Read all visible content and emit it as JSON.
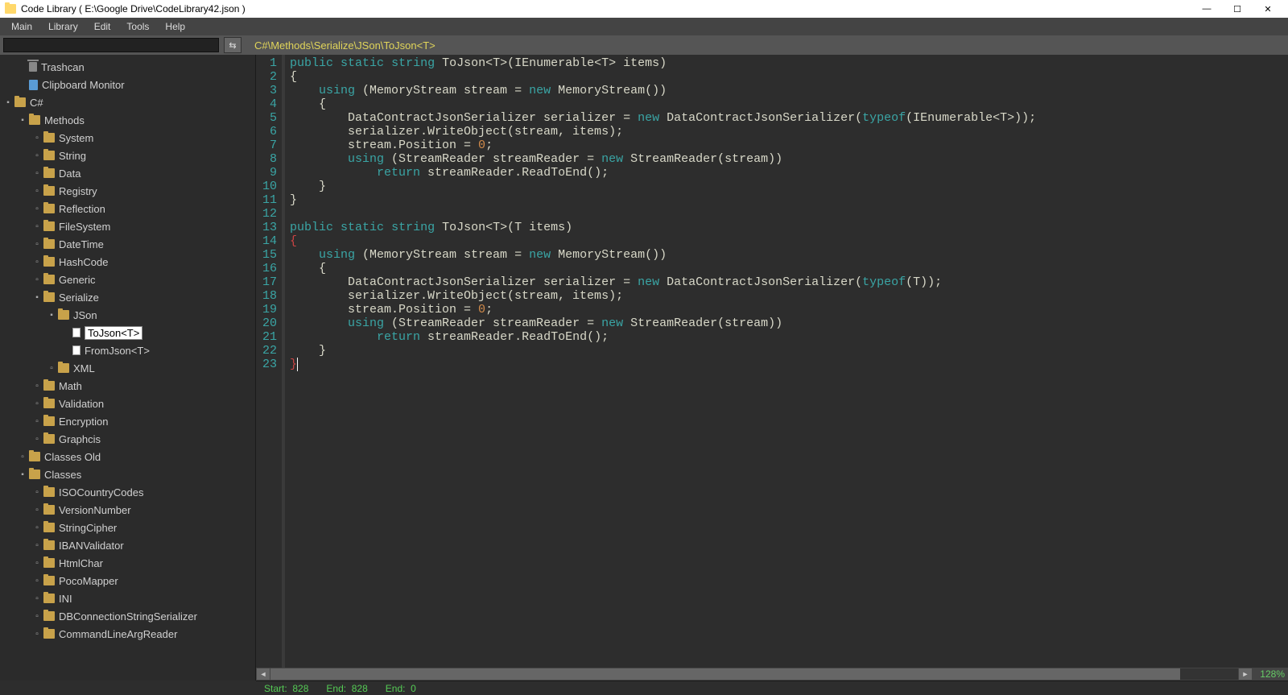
{
  "titlebar": {
    "title": "Code Library ( E:\\Google Drive\\CodeLibrary42.json )"
  },
  "menu": {
    "items": [
      "Main",
      "Library",
      "Edit",
      "Tools",
      "Help"
    ]
  },
  "toolbar": {
    "search_placeholder": "",
    "breadcrumb": "C#\\Methods\\Serialize\\JSon\\ToJson<T>"
  },
  "tree": {
    "top": [
      {
        "icon": "trash",
        "label": "Trashcan",
        "depth": 0,
        "expander": ""
      },
      {
        "icon": "clip",
        "label": "Clipboard Monitor",
        "depth": 0,
        "expander": ""
      }
    ],
    "csharp": {
      "label": "C#",
      "methods_label": "Methods",
      "methods_children": [
        "System",
        "String",
        "Data",
        "Registry",
        "Reflection",
        "FileSystem",
        "DateTime",
        "HashCode",
        "Generic"
      ],
      "serialize_label": "Serialize",
      "json_label": "JSon",
      "json_files": [
        "ToJson<T>",
        "FromJson<T>"
      ],
      "after_serialize": [
        "XML"
      ],
      "after_methods": [
        "Math",
        "Validation",
        "Encryption",
        "Graphcis"
      ],
      "classes_old_label": "Classes Old",
      "classes_label": "Classes",
      "classes_children": [
        "ISOCountryCodes",
        "VersionNumber",
        "StringCipher",
        "IBANValidator",
        "HtmlChar",
        "PocoMapper",
        "INI",
        "DBConnectionStringSerializer",
        "CommandLineArgReader"
      ]
    }
  },
  "code": {
    "lines": 23,
    "content": [
      {
        "t": "public static string ToJson<T>(IEnumerable<T> items)",
        "kw": [
          "public",
          "static",
          "string"
        ]
      },
      {
        "t": "{"
      },
      {
        "t": "    using (MemoryStream stream = new MemoryStream())",
        "kw": [
          "using"
        ],
        "new": [
          "new"
        ]
      },
      {
        "t": "    {"
      },
      {
        "t": "        DataContractJsonSerializer serializer = new DataContractJsonSerializer(typeof(IEnumerable<T>));",
        "new": [
          "new"
        ],
        "typeof": [
          "typeof"
        ]
      },
      {
        "t": "        serializer.WriteObject(stream, items);"
      },
      {
        "t": "        stream.Position = 0;",
        "num": [
          "0"
        ]
      },
      {
        "t": "        using (StreamReader streamReader = new StreamReader(stream))",
        "kw": [
          "using"
        ],
        "new": [
          "new"
        ]
      },
      {
        "t": "            return streamReader.ReadToEnd();",
        "kw": [
          "return"
        ]
      },
      {
        "t": "    }"
      },
      {
        "t": "}"
      },
      {
        "t": ""
      },
      {
        "t": "public static string ToJson<T>(T items)",
        "kw": [
          "public",
          "static",
          "string"
        ]
      },
      {
        "t": "{",
        "brace_r": true
      },
      {
        "t": "    using (MemoryStream stream = new MemoryStream())",
        "kw": [
          "using"
        ],
        "new": [
          "new"
        ]
      },
      {
        "t": "    {"
      },
      {
        "t": "        DataContractJsonSerializer serializer = new DataContractJsonSerializer(typeof(T));",
        "new": [
          "new"
        ],
        "typeof": [
          "typeof"
        ]
      },
      {
        "t": "        serializer.WriteObject(stream, items);"
      },
      {
        "t": "        stream.Position = 0;",
        "num": [
          "0"
        ]
      },
      {
        "t": "        using (StreamReader streamReader = new StreamReader(stream))",
        "kw": [
          "using"
        ],
        "new": [
          "new"
        ]
      },
      {
        "t": "            return streamReader.ReadToEnd();",
        "kw": [
          "return"
        ]
      },
      {
        "t": "    }"
      },
      {
        "t": "}",
        "brace_r": true,
        "cursor": true
      }
    ]
  },
  "status": {
    "start_label": "Start:",
    "start_val": "828",
    "end_label": "End:",
    "end_val": "828",
    "end2_label": "End:",
    "end2_val": "0",
    "zoom": "128%"
  }
}
